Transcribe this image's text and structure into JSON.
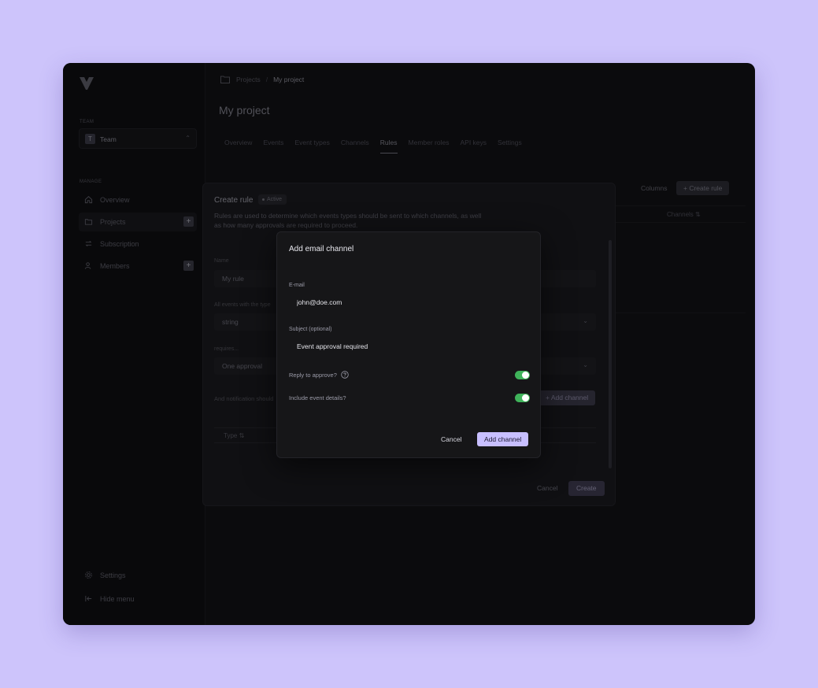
{
  "colors": {
    "page_background": "#cdc4fb",
    "accent": "#c8bfff",
    "toggle_on": "#3fb35a"
  },
  "sidebar": {
    "team_section_label": "TEAM",
    "team": {
      "avatar_letter": "T",
      "name": "Team"
    },
    "manage_section_label": "MANAGE",
    "items": [
      {
        "label": "Overview",
        "icon": "home-icon"
      },
      {
        "label": "Projects",
        "icon": "folder-icon"
      },
      {
        "label": "Subscription",
        "icon": "refresh-icon"
      },
      {
        "label": "Members",
        "icon": "users-icon"
      }
    ],
    "footer": [
      {
        "label": "Settings",
        "icon": "gear-icon"
      },
      {
        "label": "Hide menu",
        "icon": "collapse-icon"
      }
    ],
    "plus_symbol": "+"
  },
  "header": {
    "breadcrumb": {
      "parent": "Projects",
      "separator": "/",
      "current": "My project"
    },
    "title": "My project",
    "tabs": [
      "Overview",
      "Events",
      "Event types",
      "Channels",
      "Rules",
      "Member roles",
      "API keys",
      "Settings"
    ],
    "active_tab": "Rules"
  },
  "toolbar": {
    "columns_label": "Columns",
    "create_rule_label": "+  Create rule"
  },
  "bg_table": {
    "column_header": "Channels ⇅"
  },
  "rule_panel": {
    "title": "Create rule",
    "badge": "Active",
    "description": "Rules are used to determine which events types should be sent to which channels, as well as how many approvals are required to proceed.",
    "fields": [
      {
        "label": "Name",
        "value": "My rule",
        "has_chevron": false
      },
      {
        "label": "All events with the type",
        "value": "string",
        "has_chevron": true
      },
      {
        "label": "requires...",
        "value": "One approval",
        "has_chevron": true
      }
    ],
    "notification_label": "And notification should",
    "add_channel_label": "+  Add channel",
    "table_col_type": "Type ⇅",
    "cancel_label": "Cancel",
    "create_label": "Create"
  },
  "email_modal": {
    "title": "Add email channel",
    "email_label": "E-mail",
    "email_value": "john@doe.com",
    "subject_label": "Subject (optional)",
    "subject_value": "Event approval required",
    "reply_label": "Reply to approve?",
    "reply_enabled": true,
    "details_label": "Include event details?",
    "details_enabled": true,
    "cancel_label": "Cancel",
    "submit_label": "Add channel"
  }
}
